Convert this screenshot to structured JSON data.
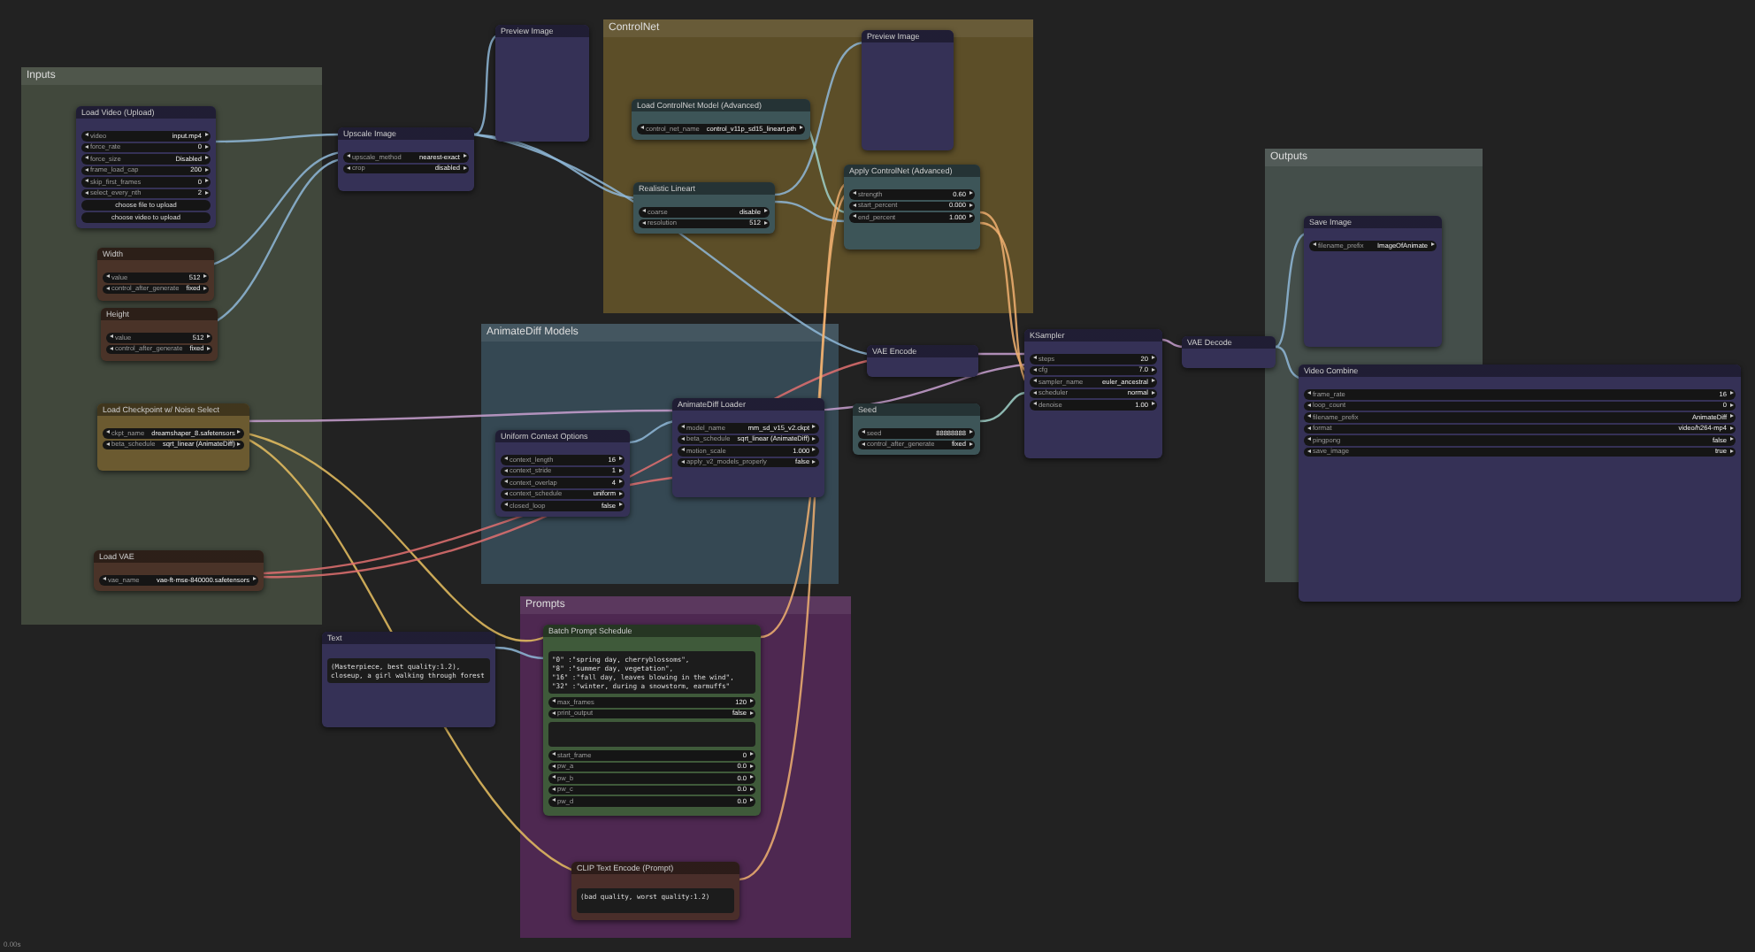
{
  "groups": [
    {
      "title": "Inputs",
      "color": "#4a5244"
    },
    {
      "title": "ControlNet",
      "color": "#6b5a2a"
    },
    {
      "title": "AnimateDiff Models",
      "color": "#3b5260"
    },
    {
      "title": "Prompts",
      "color": "#5a2a5e"
    },
    {
      "title": "Outputs",
      "color": "#4d5a55"
    }
  ],
  "nodes": [
    {
      "title": "Load Video (Upload)",
      "color": "#353156",
      "rows": [
        {
          "kind": "widget",
          "label": "video",
          "value": "input.mp4"
        },
        {
          "kind": "widget",
          "label": "force_rate",
          "value": "0"
        },
        {
          "kind": "widget",
          "label": "force_size",
          "value": "Disabled"
        },
        {
          "kind": "widget",
          "label": "frame_load_cap",
          "value": "200"
        },
        {
          "kind": "widget",
          "label": "skip_first_frames",
          "value": "0"
        },
        {
          "kind": "widget",
          "label": "select_every_nth",
          "value": "2"
        },
        {
          "kind": "button",
          "label": "choose file to upload"
        },
        {
          "kind": "button",
          "label": "choose video to upload"
        }
      ]
    },
    {
      "title": "Width",
      "color": "#4a3328",
      "rows": [
        {
          "kind": "widget",
          "label": "value",
          "value": "512"
        },
        {
          "kind": "widget",
          "label": "control_after_generate",
          "value": "fixed"
        }
      ]
    },
    {
      "title": "Height",
      "color": "#4a3328",
      "rows": [
        {
          "kind": "widget",
          "label": "value",
          "value": "512"
        },
        {
          "kind": "widget",
          "label": "control_after_generate",
          "value": "fixed"
        }
      ]
    },
    {
      "title": "Load Checkpoint w/ Noise Select",
      "color": "#6b5a30",
      "rows": [
        {
          "kind": "widget",
          "label": "ckpt_name",
          "value": "dreamshaper_8.safetensors"
        },
        {
          "kind": "widget",
          "label": "beta_schedule",
          "value": "sqrt_linear (AnimateDiff)"
        }
      ]
    },
    {
      "title": "Load VAE",
      "color": "#4a3328",
      "rows": [
        {
          "kind": "widget",
          "label": "vae_name",
          "value": "vae-ft-mse-840000.safetensors"
        }
      ]
    },
    {
      "title": "Upscale Image",
      "color": "#353156",
      "rows": [
        {
          "kind": "widget",
          "label": "upscale_method",
          "value": "nearest-exact"
        },
        {
          "kind": "widget",
          "label": "crop",
          "value": "disabled"
        }
      ]
    },
    {
      "title": "Preview Image",
      "color": "#353156"
    },
    {
      "title": "Load ControlNet Model (Advanced)",
      "color": "#3d5558",
      "rows": [
        {
          "kind": "widget",
          "label": "control_net_name",
          "value": "control_v11p_sd15_lineart.pth"
        }
      ]
    },
    {
      "title": "Preview Image",
      "color": "#353156"
    },
    {
      "title": "Realistic Lineart",
      "color": "#3d5558",
      "rows": [
        {
          "kind": "widget",
          "label": "coarse",
          "value": "disable"
        },
        {
          "kind": "widget",
          "label": "resolution",
          "value": "512"
        }
      ]
    },
    {
      "title": "Apply ControlNet (Advanced)",
      "color": "#3d5558",
      "rows": [
        {
          "kind": "widget",
          "label": "strength",
          "value": "0.60"
        },
        {
          "kind": "widget",
          "label": "start_percent",
          "value": "0.000"
        },
        {
          "kind": "widget",
          "label": "end_percent",
          "value": "1.000"
        }
      ]
    },
    {
      "title": "Uniform Context Options",
      "color": "#353156",
      "rows": [
        {
          "kind": "widget",
          "label": "context_length",
          "value": "16"
        },
        {
          "kind": "widget",
          "label": "context_stride",
          "value": "1"
        },
        {
          "kind": "widget",
          "label": "context_overlap",
          "value": "4"
        },
        {
          "kind": "widget",
          "label": "context_schedule",
          "value": "uniform"
        },
        {
          "kind": "widget",
          "label": "closed_loop",
          "value": "false"
        }
      ]
    },
    {
      "title": "AnimateDiff Loader",
      "color": "#353156",
      "rows": [
        {
          "kind": "widget",
          "label": "model_name",
          "value": "mm_sd_v15_v2.ckpt"
        },
        {
          "kind": "widget",
          "label": "beta_schedule",
          "value": "sqrt_linear (AnimateDiff)"
        },
        {
          "kind": "widget",
          "label": "motion_scale",
          "value": "1.000"
        },
        {
          "kind": "widget",
          "label": "apply_v2_models_properly",
          "value": "false"
        }
      ]
    },
    {
      "title": "VAE Encode",
      "color": "#353156"
    },
    {
      "title": "Seed",
      "color": "#3d5558",
      "rows": [
        {
          "kind": "widget",
          "label": "seed",
          "value": "88888888"
        },
        {
          "kind": "widget",
          "label": "control_after_generate",
          "value": "fixed"
        }
      ]
    },
    {
      "title": "KSampler",
      "color": "#353156",
      "rows": [
        {
          "kind": "widget",
          "label": "steps",
          "value": "20"
        },
        {
          "kind": "widget",
          "label": "cfg",
          "value": "7.0"
        },
        {
          "kind": "widget",
          "label": "sampler_name",
          "value": "euler_ancestral"
        },
        {
          "kind": "widget",
          "label": "scheduler",
          "value": "normal"
        },
        {
          "kind": "widget",
          "label": "denoise",
          "value": "1.00"
        }
      ]
    },
    {
      "title": "VAE Decode",
      "color": "#353156"
    },
    {
      "title": "Save Image",
      "color": "#353156",
      "rows": [
        {
          "kind": "widget",
          "label": "filename_prefix",
          "value": "ImageOfAnimate"
        }
      ]
    },
    {
      "title": "Video Combine",
      "color": "#353156",
      "rows": [
        {
          "kind": "widget",
          "label": "frame_rate",
          "value": "16"
        },
        {
          "kind": "widget",
          "label": "loop_count",
          "value": "0"
        },
        {
          "kind": "widget",
          "label": "filename_prefix",
          "value": "AnimateDiff"
        },
        {
          "kind": "widget",
          "label": "format",
          "value": "video/h264-mp4"
        },
        {
          "kind": "widget",
          "label": "pingpong",
          "value": "false"
        },
        {
          "kind": "widget",
          "label": "save_image",
          "value": "true"
        }
      ]
    },
    {
      "title": "Text",
      "color": "#353156",
      "rows": [
        {
          "kind": "textarea",
          "text": "(Masterpiece, best quality:1.2), closeup, a girl walking through forest"
        }
      ]
    },
    {
      "title": "Batch Prompt Schedule",
      "color": "#3f5a3a",
      "rows": [
        {
          "kind": "textarea",
          "text": "\"0\" :\"spring day, cherryblossoms\",\n\"8\" :\"summer day, vegetation\",\n\"16\" :\"fall day, leaves blowing in the wind\",\n\"32\" :\"winter, during a snowstorm, earmuffs\""
        },
        {
          "kind": "widget",
          "label": "max_frames",
          "value": "120"
        },
        {
          "kind": "widget",
          "label": "print_output",
          "value": "false"
        },
        {
          "kind": "textarea"
        },
        {
          "kind": "widget",
          "label": "start_frame",
          "value": "0"
        },
        {
          "kind": "widget",
          "label": "pw_a",
          "value": "0.0"
        },
        {
          "kind": "widget",
          "label": "pw_b",
          "value": "0.0"
        },
        {
          "kind": "widget",
          "label": "pw_c",
          "value": "0.0"
        },
        {
          "kind": "widget",
          "label": "pw_d",
          "value": "0.0"
        }
      ]
    },
    {
      "title": "CLIP Text Encode (Prompt)",
      "color": "#4a2e2a",
      "rows": [
        {
          "kind": "textarea",
          "text": "(bad quality, worst quality:1.2)"
        }
      ]
    }
  ],
  "status_text": "0.00s"
}
